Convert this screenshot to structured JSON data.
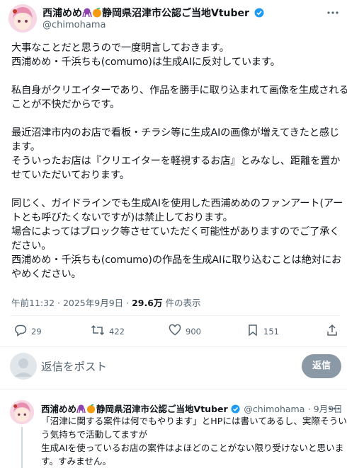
{
  "tweet": {
    "author_name": "西浦めめ",
    "author_suffix": "静岡県沼津市公認ご当地Vtuber",
    "handle": "@chimohama",
    "body_lines": [
      "大事なことだと思うので一度明言しておきます。",
      "西浦めめ・千浜ちも(comumo)は生成AIに反対しています。",
      "",
      "私自身がクリエイターであり、作品を勝手に取り込まれて画像を生成される",
      "ことが不快だからです。",
      "",
      "最近沼津市内のお店で看板・チラシ等に生成AIの画像が増えてきたと感じ",
      "ます。",
      "そういったお店は『クリエイターを軽視するお店』とみなし、距離を置か",
      "せていただいております。",
      "",
      "同じく、ガイドラインでも生成AIを使用した西浦めめのファンアート(アー",
      "トとも呼びたくないですが)は禁止しております。",
      "場合によってはブロック等させていただく可能性がありますのでご了承く",
      "ださい。",
      "西浦めめ・千浜ちも(comumo)の作品を生成AIに取り込むことは絶対にお",
      "やめください。"
    ],
    "timestamp": "午前11:32 · 2025年9月9日",
    "views_count": "29.6万",
    "views_label": "件の表示",
    "actions": {
      "replies": "29",
      "retweets": "422",
      "likes": "900",
      "bookmarks": "151"
    }
  },
  "compose": {
    "placeholder": "返信をポスト",
    "button_label": "返信"
  },
  "reply": {
    "author_name": "西浦めめ",
    "author_suffix": "静岡県沼津市公認ご当地Vtuber",
    "handle": "@chimohama",
    "date": "· 9月9日",
    "body_lines": [
      "「沼津に関する案件は何でもやります」とHPには書いてあるし、実際そうい",
      "う気持ちで活動してますが",
      "生成AIを使っているお店の案件はよほどのことがない限り受けないと思いま",
      "す。すみません。"
    ]
  },
  "colors": {
    "verified": "#1d9bf0",
    "muted": "#536471",
    "reply_button": "#8b98a5",
    "emoji_octopus": "#8e44ad",
    "emoji_orange": "#f39c12"
  },
  "icons": {
    "more": "more-dots-icon",
    "reply": "reply-icon",
    "retweet": "retweet-icon",
    "like": "heart-icon",
    "bookmark": "bookmark-icon",
    "share": "share-icon",
    "verified": "verified-badge-icon"
  }
}
